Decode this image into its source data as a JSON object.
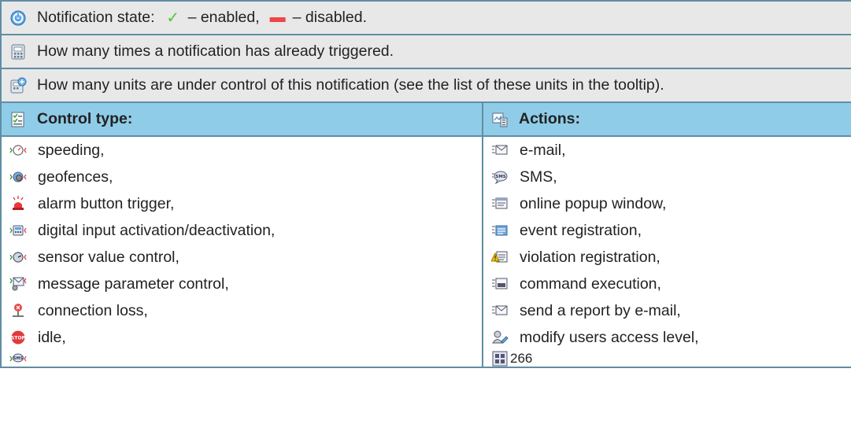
{
  "info_rows": {
    "state_prefix": "Notification state:",
    "state_enabled": "– enabled,",
    "state_disabled": "– disabled.",
    "triggered": "How many times a notification has already triggered.",
    "units": "How many units are under control of this notification (see the list of these units in the tooltip)."
  },
  "headers": {
    "control_type": "Control type:",
    "actions": "Actions:"
  },
  "control_types": [
    {
      "label": "speeding,",
      "icon": "speedometer-icon"
    },
    {
      "label": "geofences,",
      "icon": "geofence-icon"
    },
    {
      "label": "alarm button trigger,",
      "icon": "alarm-siren-icon"
    },
    {
      "label": "digital input activation/deactivation,",
      "icon": "digital-input-icon"
    },
    {
      "label": "sensor value control,",
      "icon": "sensor-gauge-icon"
    },
    {
      "label": "message parameter control,",
      "icon": "message-parameter-icon"
    },
    {
      "label": "connection loss,",
      "icon": "connection-loss-icon"
    },
    {
      "label": "idle,",
      "icon": "stop-sign-icon"
    },
    {
      "label": "",
      "icon": "sms-control-icon"
    }
  ],
  "actions": [
    {
      "label": "e-mail,",
      "icon": "email-icon"
    },
    {
      "label": "SMS,",
      "icon": "sms-bubble-icon"
    },
    {
      "label": "online popup window,",
      "icon": "popup-window-icon"
    },
    {
      "label": "event registration,",
      "icon": "event-registration-icon"
    },
    {
      "label": "violation registration,",
      "icon": "violation-warning-icon"
    },
    {
      "label": "command execution,",
      "icon": "command-execution-icon"
    },
    {
      "label": "send a report by e-mail,",
      "icon": "report-email-icon"
    },
    {
      "label": "modify users access level,",
      "icon": "user-access-icon"
    },
    {
      "label": "266",
      "icon": "counter-icon"
    }
  ],
  "colors": {
    "border": "#5f8ea3",
    "info_bg": "#e8e8e8",
    "header_bg": "#8fcce8",
    "enabled": "#54c53a",
    "disabled": "#f04545"
  }
}
